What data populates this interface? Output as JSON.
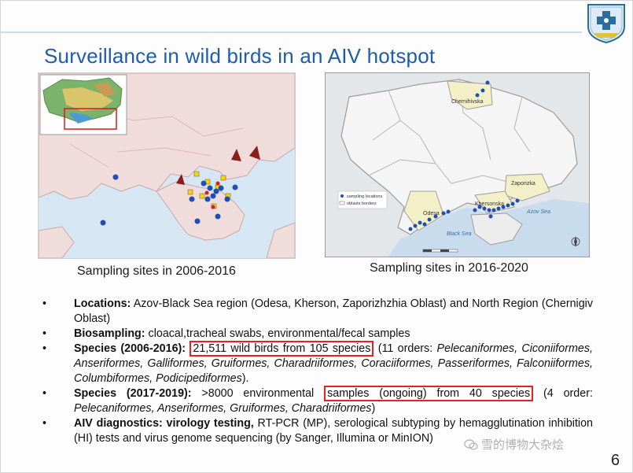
{
  "title": "Surveillance in wild birds in an AIV hotspot",
  "page_number": "6",
  "watermark": "雪的博物大杂烩",
  "left_panel": {
    "caption": "Sampling sites in 2006-2016"
  },
  "right_panel": {
    "caption": "Sampling sites in 2016-2020",
    "labels": {
      "chernihiv": "Chernihivska",
      "zaporizka": "Zaporizka",
      "khersonska": "Khersonska",
      "odesa": "Odesa",
      "azov_sea": "Azov Sea",
      "black_sea": "Black Sea"
    },
    "legend": {
      "sampling_locations": "sampling locations",
      "oblasts_borders": "oblasts borders"
    }
  },
  "bullets": [
    {
      "label": "Locations:",
      "text": "Azov-Black Sea region (Odesa, Kherson, Zaporizhzhia Oblast) and North Region (Chernigiv Oblast)"
    },
    {
      "label": "Biosampling:",
      "text": "cloacal,tracheal swabs, environmental/fecal samples"
    },
    {
      "label": "Species (2006-2016):",
      "boxed": "21,511 wild birds from 105 species",
      "text_plain": "(11 orders:",
      "text_italic": "Pelecaniformes, Ciconiiformes, Anseriformes, Galliformes, Gruiformes, Charadriiformes, Coraciiformes, Passeriformes, Falconiiformes, Columbiformes, Podicipediformes",
      "text_end": ")."
    },
    {
      "label": "Species (2017-2019):",
      "text_before": ">8000 environmental",
      "boxed": "samples (ongoing) from 40 species",
      "text_plain": "(4 order:",
      "text_italic": "Pelecaniformes, Anseriformes, Gruiformes, Charadriiformes",
      "text_end": ")"
    },
    {
      "label": "AIV diagnostics: virology testing,",
      "text": "RT-PCR (MP), serological subtyping by hemagglutination inhibition (HI) tests and virus genome sequencing (by Sanger, Illumina or MinION)"
    }
  ],
  "colors": {
    "title": "#1f5da8",
    "highlight_box": "#e8201f",
    "map_land": "#f1dcdc",
    "map_sea": "#d7e6f3",
    "sample_point": "#1f4fb5",
    "oblast_fill": "#f3f0c8"
  }
}
